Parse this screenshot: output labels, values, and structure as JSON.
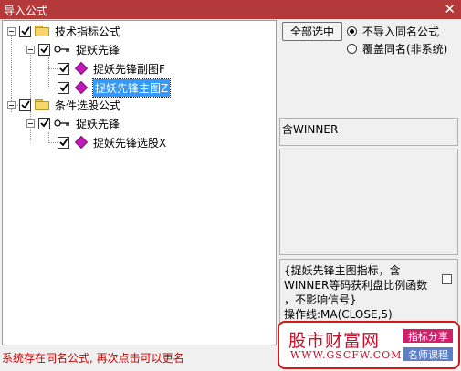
{
  "window": {
    "title": "导入公式",
    "close_glyph": "✕"
  },
  "tree": {
    "items": [
      {
        "label": "技术指标公式",
        "type": "folder",
        "checked": true
      },
      {
        "label": "捉妖先锋",
        "type": "group",
        "checked": true
      },
      {
        "label": "捉妖先锋副图F",
        "type": "formula",
        "checked": true
      },
      {
        "label": "捉妖先锋主图Z",
        "type": "formula",
        "checked": true,
        "selected": true
      },
      {
        "label": "条件选股公式",
        "type": "folder",
        "checked": true
      },
      {
        "label": "捉妖先锋",
        "type": "group",
        "checked": true
      },
      {
        "label": "捉妖先锋选股X",
        "type": "formula",
        "checked": true
      }
    ]
  },
  "buttons": {
    "select_all": "全部选中"
  },
  "options": {
    "no_import_same_name": "不导入同名公式",
    "overwrite_same_name": "覆盖同名(非系统)",
    "selected": "no_import_same_name"
  },
  "info": {
    "contains": "含WINNER",
    "description": "{捉妖先锋主图指标，含\nWINNER等码获利盘比例函数\n，不影响信号}\n操作线:MA(CLOSE,5)"
  },
  "status": {
    "message": "系统存在同名公式, 再次点击可以更名"
  },
  "watermark": {
    "name": "股市财富网",
    "url": "WWW.GSCFW.COM",
    "tag1": "指标分享",
    "tag2": "名师课程"
  },
  "colors": {
    "titlebar": "#b4393a",
    "selection": "#3399ff",
    "status_text": "#d40000",
    "formula_icon": "#c21ab8"
  }
}
